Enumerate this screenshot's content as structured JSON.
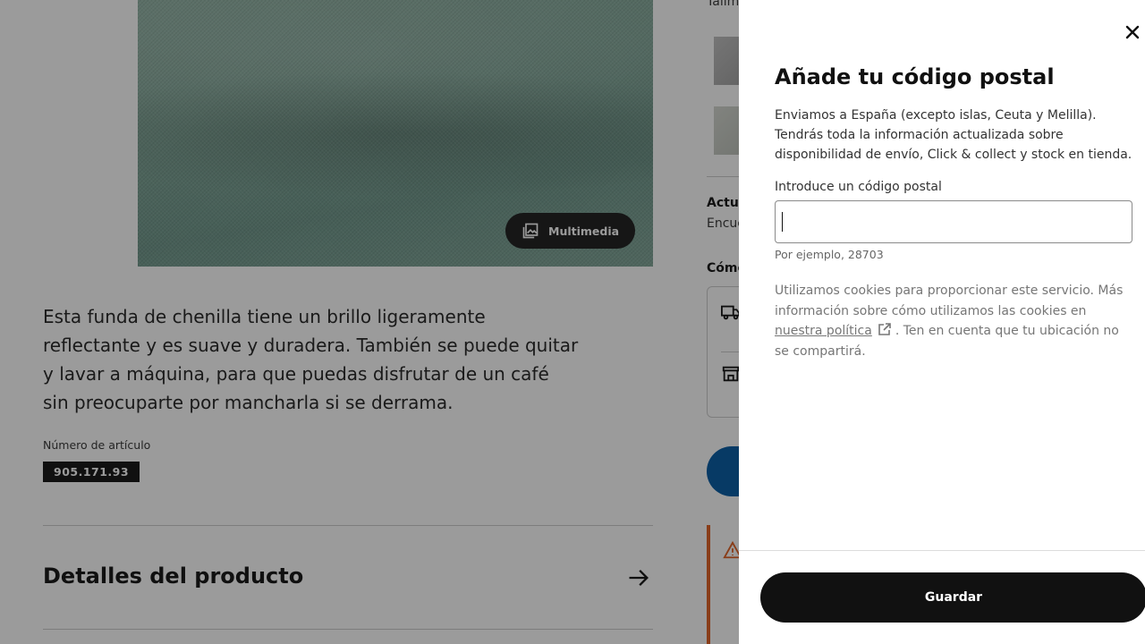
{
  "product_page": {
    "media_button_label": "Multimedia",
    "description": "Esta funda de chenilla tiene un brillo ligeramente reflectante y es suave y duradera. También se puede quitar y lavar a máquina, para que puedas disfrutar de un café sin preocuparte por mancharla si se derrama.",
    "article_label": "Número de artículo",
    "article_number": "905.171.93",
    "details_title": "Detalles del producto",
    "right_column": {
      "size_label": "Tallm",
      "update_title": "Actua",
      "update_text": "Encue",
      "how_title": "Cómo"
    }
  },
  "modal": {
    "title": "Añade tu código postal",
    "description": "Enviamos a España (excepto islas, Ceuta y Melilla). Tendrás toda la información actualizada sobre disponibilidad de envío, Click & collect y stock en tienda.",
    "postal_label": "Introduce un código postal",
    "postal_value": "",
    "postal_helper": "Por ejemplo, 28703",
    "cookie_text_before": "Utilizamos cookies para proporcionar este servicio. Más información sobre cómo utilizamos las cookies en ",
    "cookie_link": "nuestra política",
    "cookie_text_after": ". Ten en cuenta que tu ubicación no se compartirá.",
    "save_label": "Guardar"
  },
  "icons": {
    "close": "close-icon",
    "media": "image-gallery-icon",
    "arrow": "arrow-right-icon",
    "external": "external-link-icon",
    "truck": "delivery-truck-icon",
    "store": "store-icon",
    "warning": "warning-icon"
  },
  "colors": {
    "overlay": "#111111",
    "primary_button": "#111111",
    "blue_button": "#0058a3",
    "warning_accent": "#e05d20"
  }
}
